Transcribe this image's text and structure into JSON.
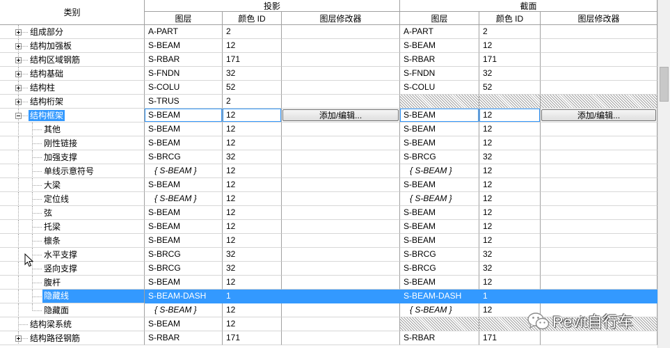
{
  "header": {
    "category": "类别",
    "projection": "投影",
    "section": "截面",
    "columns": [
      "图层",
      "颜色 ID",
      "图层修改器",
      "图层",
      "颜色 ID",
      "图层修改器"
    ]
  },
  "rows": [
    {
      "label": "组成部分",
      "level": 0,
      "expander": "plus",
      "projection": {
        "layer": "A-PART",
        "color_id": "2"
      },
      "section": {
        "layer": "A-PART",
        "color_id": "2"
      }
    },
    {
      "label": "结构加强板",
      "level": 0,
      "expander": "plus",
      "projection": {
        "layer": "S-BEAM",
        "color_id": "12"
      },
      "section": {
        "layer": "S-BEAM",
        "color_id": "12"
      }
    },
    {
      "label": "结构区域钢筋",
      "level": 0,
      "expander": "plus",
      "projection": {
        "layer": "S-RBAR",
        "color_id": "171"
      },
      "section": {
        "layer": "S-RBAR",
        "color_id": "171"
      }
    },
    {
      "label": "结构基础",
      "level": 0,
      "expander": "plus",
      "projection": {
        "layer": "S-FNDN",
        "color_id": "32"
      },
      "section": {
        "layer": "S-FNDN",
        "color_id": "32"
      }
    },
    {
      "label": "结构柱",
      "level": 0,
      "expander": "plus",
      "projection": {
        "layer": "S-COLU",
        "color_id": "52"
      },
      "section": {
        "layer": "S-COLU",
        "color_id": "52"
      }
    },
    {
      "label": "结构桁架",
      "level": 0,
      "expander": "plus",
      "projection": {
        "layer": "S-TRUS",
        "color_id": "2"
      },
      "section": {
        "hatched": true
      }
    },
    {
      "label": "结构框架",
      "level": 0,
      "expander": "minus",
      "state": "editing",
      "label_selected": true,
      "projection": {
        "layer": "S-BEAM",
        "color_id": "12",
        "modifier_button": "添加/编辑..."
      },
      "section": {
        "layer": "S-BEAM",
        "color_id": "12",
        "modifier_button": "添加/编辑..."
      }
    },
    {
      "label": "其他",
      "level": 1,
      "projection": {
        "layer": "S-BEAM",
        "color_id": "12"
      },
      "section": {
        "layer": "S-BEAM",
        "color_id": "12"
      }
    },
    {
      "label": "刚性链接",
      "level": 1,
      "projection": {
        "layer": "S-BEAM",
        "color_id": "12"
      },
      "section": {
        "layer": "S-BEAM",
        "color_id": "12"
      }
    },
    {
      "label": "加强支撑",
      "level": 1,
      "projection": {
        "layer": "S-BRCG",
        "color_id": "32"
      },
      "section": {
        "layer": "S-BRCG",
        "color_id": "32"
      }
    },
    {
      "label": "单线示意符号",
      "level": 1,
      "projection": {
        "layer": "{ S-BEAM }",
        "color_id": "12"
      },
      "section": {
        "layer": "{ S-BEAM }",
        "color_id": "12"
      }
    },
    {
      "label": "大梁",
      "level": 1,
      "projection": {
        "layer": "S-BEAM",
        "color_id": "12"
      },
      "section": {
        "layer": "S-BEAM",
        "color_id": "12"
      }
    },
    {
      "label": "定位线",
      "level": 1,
      "projection": {
        "layer": "{ S-BEAM }",
        "color_id": "12"
      },
      "section": {
        "layer": "{ S-BEAM }",
        "color_id": "12"
      }
    },
    {
      "label": "弦",
      "level": 1,
      "projection": {
        "layer": "S-BEAM",
        "color_id": "12"
      },
      "section": {
        "layer": "S-BEAM",
        "color_id": "12"
      }
    },
    {
      "label": "托梁",
      "level": 1,
      "projection": {
        "layer": "S-BEAM",
        "color_id": "12"
      },
      "section": {
        "layer": "S-BEAM",
        "color_id": "12"
      }
    },
    {
      "label": "檩条",
      "level": 1,
      "projection": {
        "layer": "S-BEAM",
        "color_id": "12"
      },
      "section": {
        "layer": "S-BEAM",
        "color_id": "12"
      }
    },
    {
      "label": "水平支撑",
      "level": 1,
      "projection": {
        "layer": "S-BRCG",
        "color_id": "32"
      },
      "section": {
        "layer": "S-BRCG",
        "color_id": "32"
      }
    },
    {
      "label": "竖向支撑",
      "level": 1,
      "projection": {
        "layer": "S-BRCG",
        "color_id": "32"
      },
      "section": {
        "layer": "S-BRCG",
        "color_id": "32"
      }
    },
    {
      "label": "腹杆",
      "level": 1,
      "projection": {
        "layer": "S-BEAM",
        "color_id": "12"
      },
      "section": {
        "layer": "S-BEAM",
        "color_id": "12"
      }
    },
    {
      "label": "隐藏线",
      "level": 1,
      "state": "selected",
      "projection": {
        "layer": "S-BEAM-DASH",
        "color_id": "1"
      },
      "section": {
        "layer": "S-BEAM-DASH",
        "color_id": "1"
      }
    },
    {
      "label": "隐藏面",
      "level": 1,
      "projection": {
        "layer": "{ S-BEAM }",
        "color_id": "12"
      },
      "section": {
        "layer": "{ S-BEAM }",
        "color_id": "12"
      }
    },
    {
      "label": "结构梁系统",
      "level": 0,
      "projection": {
        "layer": "S-BEAM",
        "color_id": "12"
      },
      "section": {
        "hatched": true
      }
    },
    {
      "label": "结构路径钢筋",
      "level": 0,
      "expander": "plus",
      "projection": {
        "layer": "S-RBAR",
        "color_id": "171"
      },
      "section": {
        "layer": "S-RBAR",
        "color_id": "171"
      }
    }
  ],
  "watermark": {
    "text": "Revit自行车"
  },
  "colors": {
    "selection": "#3399ff",
    "grid_line": "#a0a0a0",
    "hatch": "#a0a0a0"
  },
  "icons": {
    "expand": "expand-plus-icon",
    "collapse": "collapse-minus-icon",
    "cursor": "mouse-cursor-icon",
    "watermark_logo": "wechat-logo-icon"
  }
}
